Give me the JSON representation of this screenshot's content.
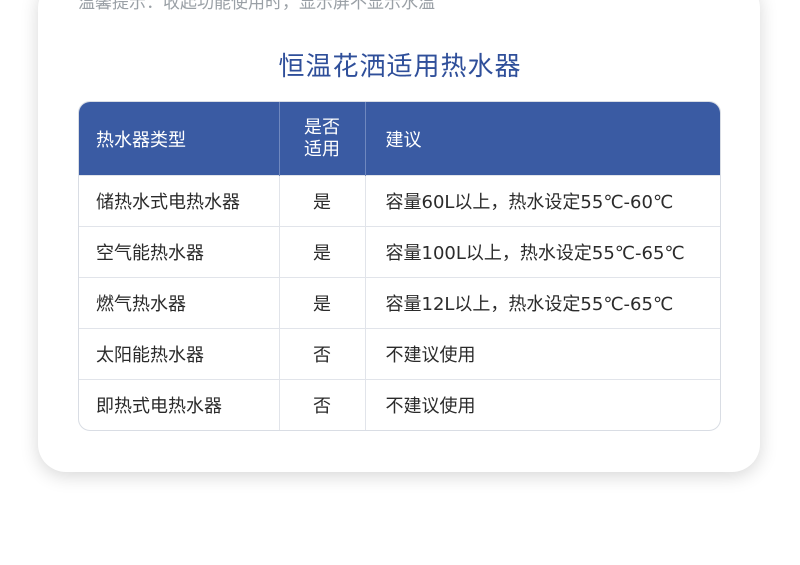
{
  "header_cutoff_text": "温馨提示：收起功能使用时，显示屏不显示水温",
  "title": "恒温花洒适用热水器",
  "table": {
    "headers": [
      "热水器类型",
      "是否\n适用",
      "建议"
    ],
    "header_line1": "是否",
    "header_line2": "适用",
    "rows": [
      {
        "type": "储热水式电热水器",
        "applicable": "是",
        "advice": "容量60L以上，热水设定55℃-60℃"
      },
      {
        "type": "空气能热水器",
        "applicable": "是",
        "advice": "容量100L以上，热水设定55℃-65℃"
      },
      {
        "type": "燃气热水器",
        "applicable": "是",
        "advice": "容量12L以上，热水设定55℃-65℃"
      },
      {
        "type": "太阳能热水器",
        "applicable": "否",
        "advice": "不建议使用"
      },
      {
        "type": "即热式电热水器",
        "applicable": "否",
        "advice": "不建议使用"
      }
    ]
  },
  "colors": {
    "header_bg": "#3a5ba3",
    "title": "#2f4f9a"
  }
}
